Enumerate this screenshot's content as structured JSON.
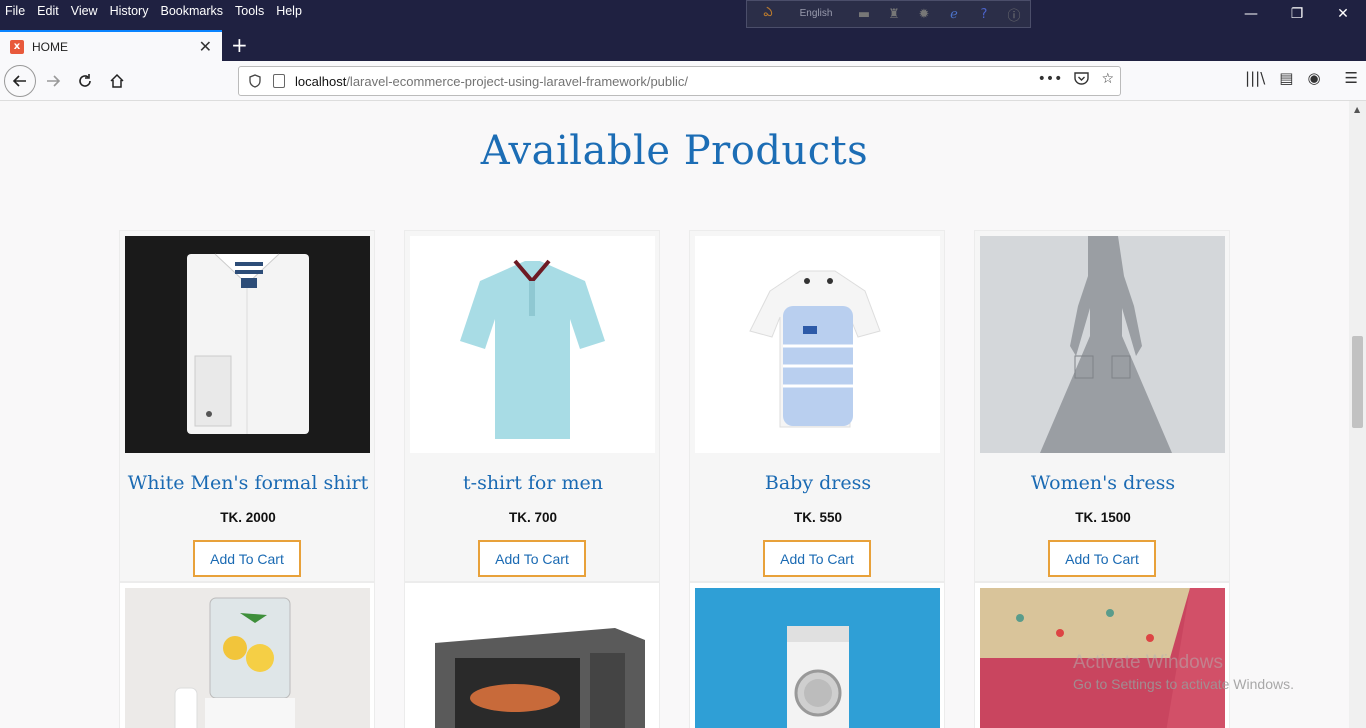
{
  "menu": [
    "File",
    "Edit",
    "View",
    "History",
    "Bookmarks",
    "Tools",
    "Help"
  ],
  "plugin_lang": "English",
  "tab": {
    "title": "HOME"
  },
  "url": {
    "host": "localhost",
    "path": "/laravel-ecommerce-project-using-laravel-framework/public/"
  },
  "page": {
    "heading": "Available Products"
  },
  "products": [
    {
      "name": "White Men's formal shirt",
      "price": "TK. 2000",
      "button": "Add To Cart"
    },
    {
      "name": "t-shirt for men",
      "price": "TK. 700",
      "button": "Add To Cart"
    },
    {
      "name": "Baby dress",
      "price": "TK. 550",
      "button": "Add To Cart"
    },
    {
      "name": "Women's dress",
      "price": "TK. 1500",
      "button": "Add To Cart"
    }
  ],
  "watermark": {
    "title": "Activate Windows",
    "line": "Go to Settings to activate Windows."
  }
}
